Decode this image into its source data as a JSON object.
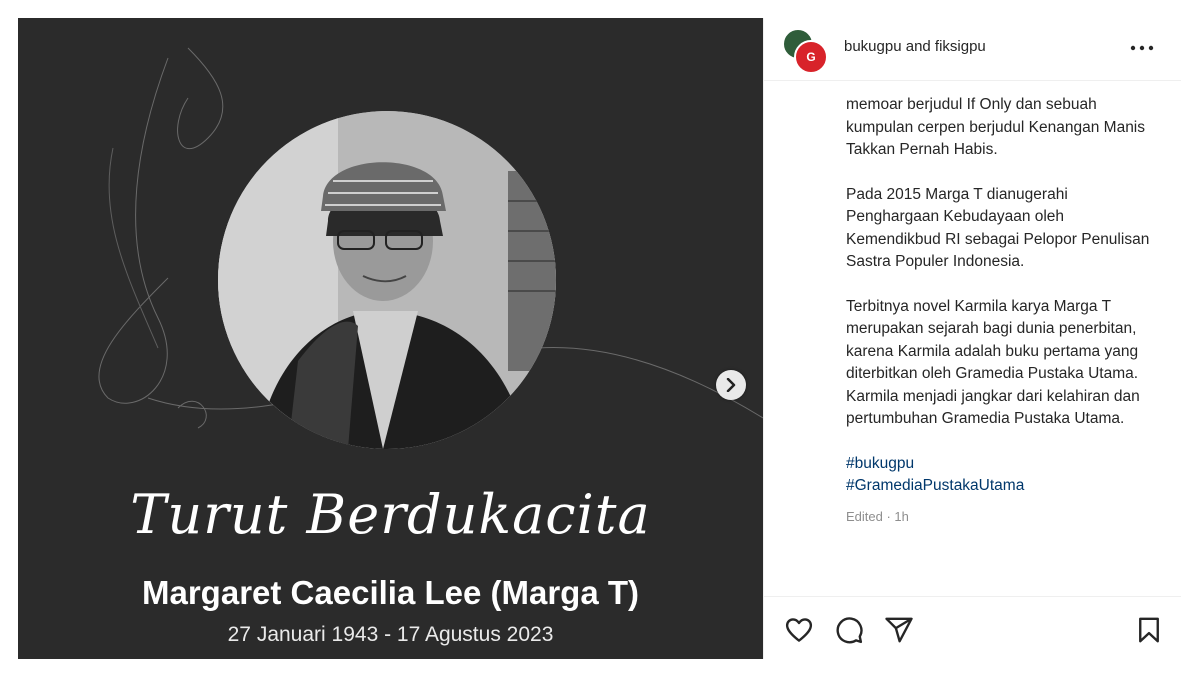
{
  "post": {
    "image": {
      "headline": "Turut Berdukacita",
      "name": "Margaret Caecilia Lee (Marga T)",
      "dates": "27 Januari 1943 - 17 Agustus 2023"
    },
    "next_icon": "chevron-right-icon"
  },
  "header": {
    "account": "bukugpu and fiksigpu",
    "avatar_front_text": "G",
    "more_icon": "more-horizontal-icon"
  },
  "caption": {
    "paragraphs": [
      "memoar berjudul If Only dan sebuah kumpulan cerpen berjudul Kenangan Manis Takkan Pernah Habis.",
      "Pada 2015 Marga T dianugerahi Penghargaan Kebudayaan oleh Kemendikbud RI sebagai Pelopor Penulisan Sastra Populer Indonesia.",
      "Terbitnya novel Karmila karya Marga T merupakan sejarah bagi dunia penerbitan, karena Karmila adalah buku pertama yang diterbitkan oleh Gramedia Pustaka Utama. Karmila menjadi jangkar dari kelahiran dan pertumbuhan Gramedia Pustaka Utama."
    ],
    "hashtags": [
      "#bukugpu",
      "#GramediaPustakaUtama"
    ],
    "edited": "Edited · 1h"
  },
  "actions": {
    "like_icon": "heart-icon",
    "comment_icon": "comment-icon",
    "share_icon": "send-icon",
    "save_icon": "bookmark-icon"
  },
  "colors": {
    "panel_bg": "#2b2b2b",
    "hashtag": "#00376b",
    "muted": "#8e8e8e"
  }
}
